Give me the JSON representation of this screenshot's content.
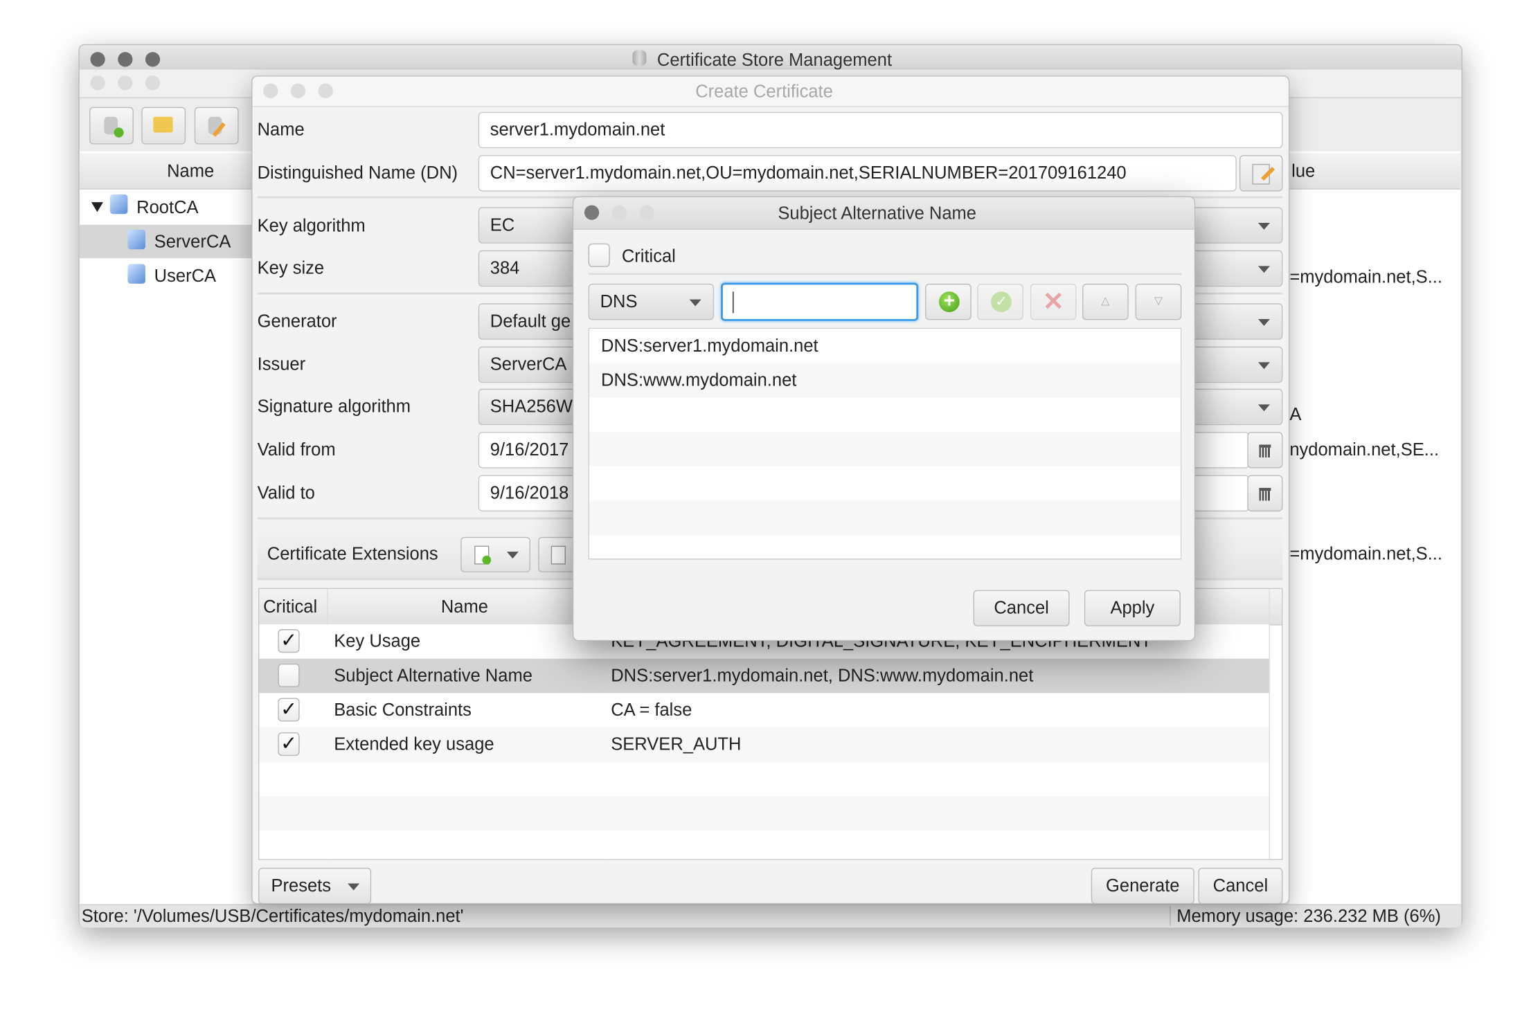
{
  "main_window": {
    "title": "Certificate Store Management",
    "tree_header": "Name",
    "value_header": "lue",
    "tree": [
      {
        "label": "RootCA",
        "expanded": true
      },
      {
        "label": "ServerCA",
        "selected": true
      },
      {
        "label": "UserCA"
      }
    ],
    "values": [
      "=mydomain.net,S...",
      "A",
      "nydomain.net,SE...",
      "=mydomain.net,S..."
    ],
    "status": {
      "store": "Store: '/Volumes/USB/Certificates/mydomain.net'",
      "memory": "Memory usage: 236.232 MB (6%)"
    },
    "toolbar_icons": [
      "new-store-icon",
      "open-store-icon",
      "edit-store-icon"
    ]
  },
  "create_dialog": {
    "title": "Create Certificate",
    "fields": {
      "name_label": "Name",
      "name_value": "server1.mydomain.net",
      "dn_label": "Distinguished Name (DN)",
      "dn_value": "CN=server1.mydomain.net,OU=mydomain.net,SERIALNUMBER=201709161240",
      "key_algorithm_label": "Key algorithm",
      "key_algorithm_value": "EC",
      "key_size_label": "Key size",
      "key_size_value": "384",
      "generator_label": "Generator",
      "generator_value": "Default ge",
      "issuer_label": "Issuer",
      "issuer_value": "ServerCA",
      "signature_label": "Signature algorithm",
      "signature_value": "SHA256W",
      "valid_from_label": "Valid from",
      "valid_from_value": "9/16/2017",
      "valid_to_label": "Valid to",
      "valid_to_value": "9/16/2018"
    },
    "extensions_label": "Certificate Extensions",
    "table": {
      "headers": [
        "Critical",
        "Name"
      ],
      "rows": [
        {
          "critical": true,
          "name": "Key Usage",
          "value": "KEY_AGREEMENT, DIGITAL_SIGNATURE, KEY_ENCIPHERMENT"
        },
        {
          "critical": false,
          "name": "Subject Alternative Name",
          "value": "DNS:server1.mydomain.net, DNS:www.mydomain.net",
          "selected": true
        },
        {
          "critical": true,
          "name": "Basic Constraints",
          "value": "CA = false"
        },
        {
          "critical": true,
          "name": "Extended key usage",
          "value": "SERVER_AUTH"
        }
      ]
    },
    "presets_label": "Presets",
    "generate_label": "Generate",
    "cancel_label": "Cancel"
  },
  "san_dialog": {
    "title": "Subject Alternative Name",
    "critical_label": "Critical",
    "critical_checked": false,
    "type_value": "DNS",
    "input_value": "",
    "entries": [
      "DNS:server1.mydomain.net",
      "DNS:www.mydomain.net"
    ],
    "cancel_label": "Cancel",
    "apply_label": "Apply"
  },
  "colors": {
    "focus": "#3b9be8",
    "add": "#5cb82a",
    "remove": "#e05a5a",
    "selection": "#d4d4d4"
  }
}
